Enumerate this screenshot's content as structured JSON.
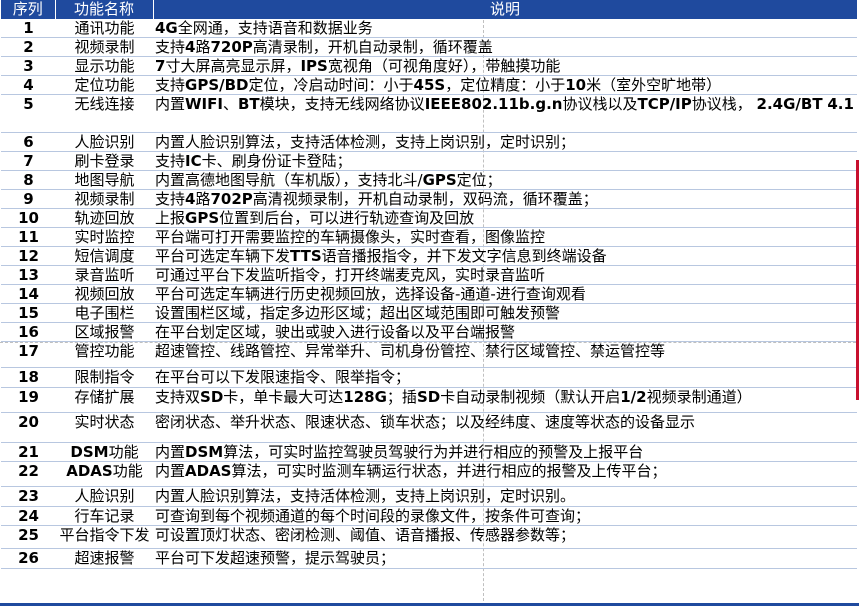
{
  "header": {
    "col_index": "序列",
    "col_name": "功能名称",
    "col_desc": "说明"
  },
  "rows": [
    {
      "num": "1",
      "name": "通讯功能",
      "desc": "4G全网通，支持语音和数据业务"
    },
    {
      "num": "2",
      "name": "视频录制",
      "desc": "支持4路720P高清录制，开机自动录制，循环覆盖"
    },
    {
      "num": "3",
      "name": "显示功能",
      "desc": "7寸大屏高亮显示屏，IPS宽视角（可视角度好），带触摸功能"
    },
    {
      "num": "4",
      "name": "定位功能",
      "desc": "支持GPS/BD定位，冷启动时间：小于45S，定位精度：小于10米（室外空旷地带）"
    },
    {
      "num": "5",
      "name": "无线连接",
      "desc": "内置WIFI、BT模块，支持无线网络协议IEEE802.11b.g.n协议栈以及TCP/IP协议栈， 2.4G/BT 4.1"
    },
    {
      "num": "6",
      "name": "人脸识别",
      "desc": "内置人脸识别算法，支持活体检测，支持上岗识别，定时识别；"
    },
    {
      "num": "7",
      "name": "刷卡登录",
      "desc": "支持IC卡、刷身份证卡登陆；"
    },
    {
      "num": "8",
      "name": "地图导航",
      "desc": "内置高德地图导航（车机版），支持北斗/GPS定位；"
    },
    {
      "num": "9",
      "name": "视频录制",
      "desc": "支持4路702P高清视频录制，开机自动录制，双码流，循环覆盖；"
    },
    {
      "num": "10",
      "name": "轨迹回放",
      "desc": "上报GPS位置到后台，可以进行轨迹查询及回放"
    },
    {
      "num": "11",
      "name": "实时监控",
      "desc": "平台端可打开需要监控的车辆摄像头，实时查看，图像监控"
    },
    {
      "num": "12",
      "name": "短信调度",
      "desc": "平台可选定车辆下发TTS语音播报指令，并下发文字信息到终端设备"
    },
    {
      "num": "13",
      "name": "录音监听",
      "desc": "可通过平台下发监听指令，打开终端麦克风，实时录音监听"
    },
    {
      "num": "14",
      "name": "视频回放",
      "desc": "平台可选定车辆进行历史视频回放，选择设备-通道-进行查询观看"
    },
    {
      "num": "15",
      "name": "电子围栏",
      "desc": "设置围栏区域，指定多边形区域；超出区域范围即可触发预警"
    },
    {
      "num": "16",
      "name": "区域报警",
      "desc": "在平台划定区域，驶出或驶入进行设备以及平台端报警"
    },
    {
      "num": "17",
      "name": "管控功能",
      "desc": "超速管控、线路管控、异常举升、司机身份管控、禁行区域管控、禁运管控等"
    },
    {
      "num": "18",
      "name": "限制指令",
      "desc": "在平台可以下发限速指令、限举指令；"
    },
    {
      "num": "19",
      "name": "存储扩展",
      "desc": "支持双SD卡，单卡最大可达128G；插SD卡自动录制视频（默认开启1/2视频录制通道）"
    },
    {
      "num": "20",
      "name": "实时状态",
      "desc": "密闭状态、举升状态、限速状态、锁车状态；以及经纬度、速度等状态的设备显示"
    },
    {
      "num": "21",
      "name": "DSM功能",
      "desc": "内置DSM算法，可实时监控驾驶员驾驶行为并进行相应的预警及上报平台"
    },
    {
      "num": "22",
      "name": "ADAS功能",
      "desc": "内置ADAS算法，可实时监测车辆运行状态，并进行相应的报警及上传平台；"
    },
    {
      "num": "23",
      "name": "人脸识别",
      "desc": "内置人脸识别算法，支持活体检测，支持上岗识别，定时识别。"
    },
    {
      "num": "24",
      "name": "行车记录",
      "desc": "可查询到每个视频通道的每个时间段的录像文件，按条件可查询；"
    },
    {
      "num": "25",
      "name": "平台指令下发",
      "desc": "可设置顶灯状态、密闭检测、阈值、语音播报、传感器参数等；"
    },
    {
      "num": "26",
      "name": "超速报警",
      "desc": "平台可下发超速预警，提示驾驶员；"
    }
  ]
}
